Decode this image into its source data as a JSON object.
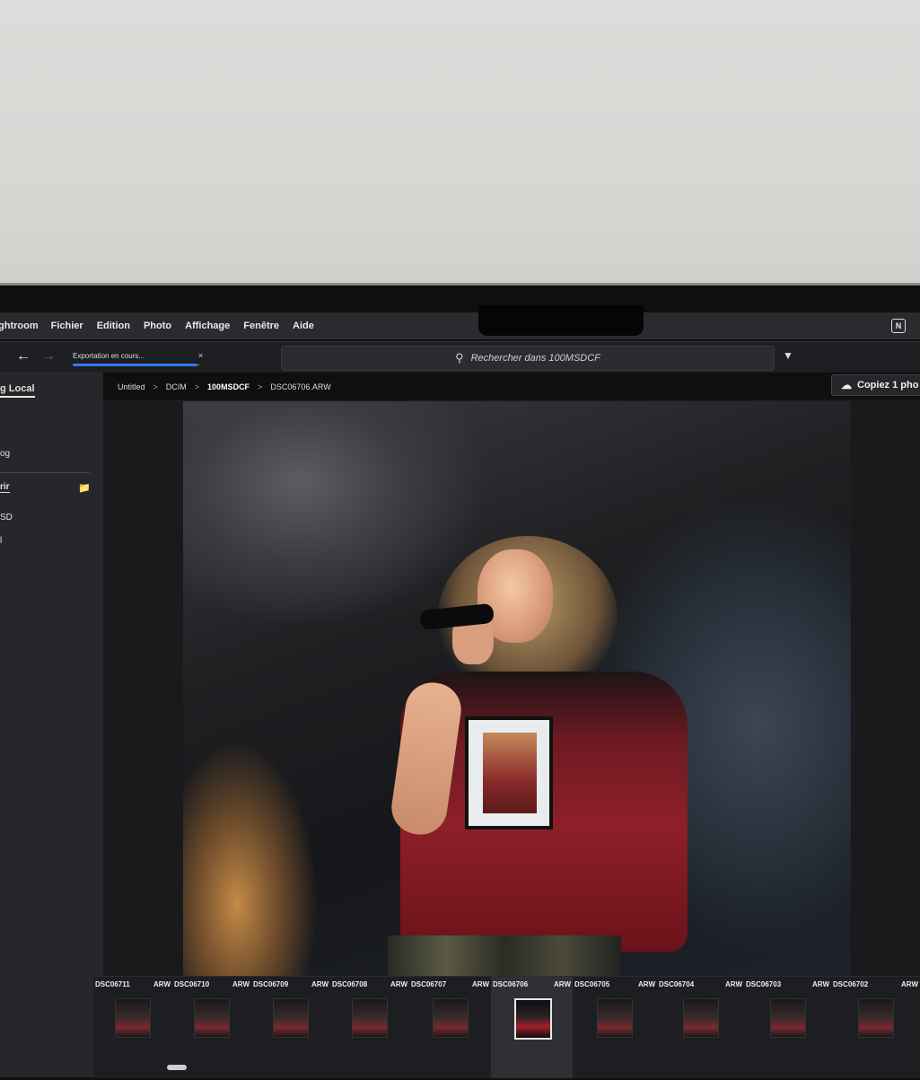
{
  "menubar": {
    "app_name": "ghtroom",
    "items": [
      "Fichier",
      "Edition",
      "Photo",
      "Affichage",
      "Fenêtre",
      "Aide"
    ],
    "badge": "N"
  },
  "toolbar": {
    "back_icon": "←",
    "forward_icon": "→",
    "export_label": "Exportation en cours...",
    "export_progress": 0.98,
    "export_close": "×",
    "search_placeholder": "Rechercher dans 100MSDCF",
    "filter_icon": "funnel-icon"
  },
  "left_panel": {
    "local_label": "g Local",
    "item1": "og",
    "item2": "rir",
    "item3": "SD",
    "item4": "l"
  },
  "breadcrumb": [
    "Untitled",
    "DCIM",
    "100MSDCF",
    "DSC06706.ARW"
  ],
  "copy_button": "Copiez 1 pho",
  "filmstrip": [
    {
      "name": "DSC06711",
      "ext": "ARW"
    },
    {
      "name": "DSC06710",
      "ext": "ARW"
    },
    {
      "name": "DSC06709",
      "ext": "ARW"
    },
    {
      "name": "DSC06708",
      "ext": "ARW"
    },
    {
      "name": "DSC06707",
      "ext": "ARW"
    },
    {
      "name": "DSC06706",
      "ext": "ARW"
    },
    {
      "name": "DSC06705",
      "ext": "ARW"
    },
    {
      "name": "DSC06704",
      "ext": "ARW"
    },
    {
      "name": "DSC06703",
      "ext": "ARW"
    },
    {
      "name": "DSC06702",
      "ext": "ARW"
    }
  ]
}
